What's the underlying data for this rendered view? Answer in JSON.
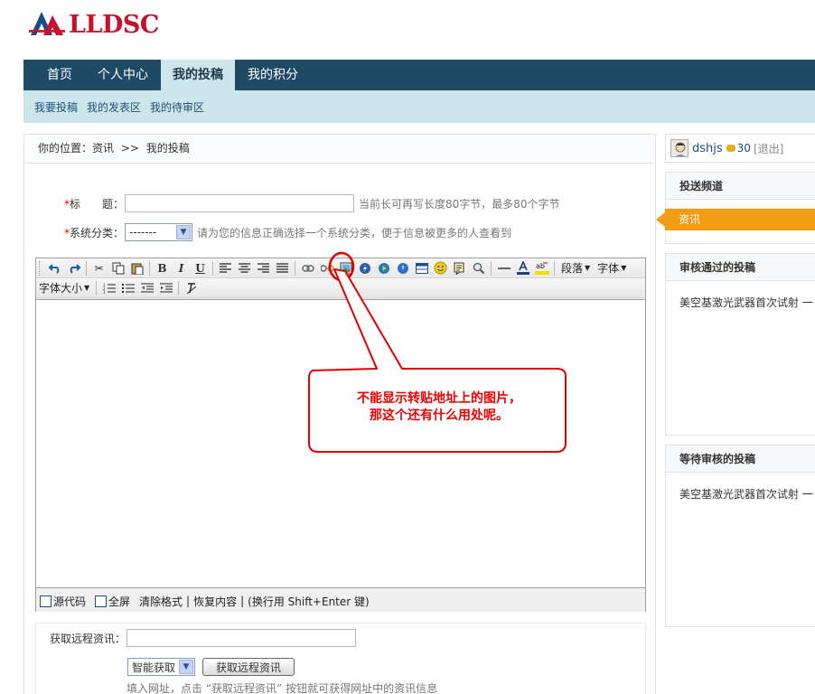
{
  "logo": {
    "text": "LLDSC"
  },
  "nav": {
    "items": [
      "首页",
      "个人中心",
      "我的投稿",
      "我的积分"
    ],
    "active_index": 2
  },
  "subnav": {
    "items": [
      "我要投稿",
      "我的发表区",
      "我的待审区"
    ]
  },
  "breadcrumb": {
    "prefix": "你的位置：",
    "section": "资讯",
    "separator": ">>",
    "current": "我的投稿"
  },
  "form": {
    "required_mark": "*",
    "title_label": "标　　题：",
    "title_value": "",
    "title_hint": "当前长可再写长度80字节，最多80个字节",
    "category_label": "系统分类：",
    "category_value": "-------",
    "category_hint": "请为您的信息正确选择一个系统分类，便于信息被更多的人查看到"
  },
  "editor": {
    "toolbar_dropdowns": {
      "paragraph": "段落",
      "font": "字体",
      "font_size": "字体大小"
    },
    "footer": {
      "source_label": "源代码",
      "fullscreen_label": "全屏",
      "clear_format": "清除格式",
      "divider": "|",
      "restore": "恢复内容",
      "newline_hint": "(换行用 Shift+Enter 键)"
    }
  },
  "remote": {
    "label": "获取远程资讯：",
    "url_value": "",
    "mode_value": "智能获取",
    "button_label": "获取远程资讯",
    "hint": "填入网址，点击 “获取远程资讯” 按钮就可获得网址中的资讯信息"
  },
  "user": {
    "name": "dshjs",
    "points": "30",
    "logout": "[退出]"
  },
  "sidebar": {
    "channel_title": "投送频道",
    "channel_active": "资讯",
    "approved_title": "审核通过的投稿",
    "approved_item": "美空基激光武器首次试射 一",
    "pending_title": "等待审核的投稿",
    "pending_item": "美空基激光武器首次试射 一"
  },
  "annotation": {
    "line1": "不能显示转贴地址上的图片，",
    "line2": "那这个还有什么用处呢。"
  },
  "colors": {
    "nav_bg": "#1f4a65",
    "subnav_bg": "#cde6ec",
    "accent_orange": "#f39b13",
    "brand_red": "#c8102e",
    "annotation_red": "#e00000"
  }
}
